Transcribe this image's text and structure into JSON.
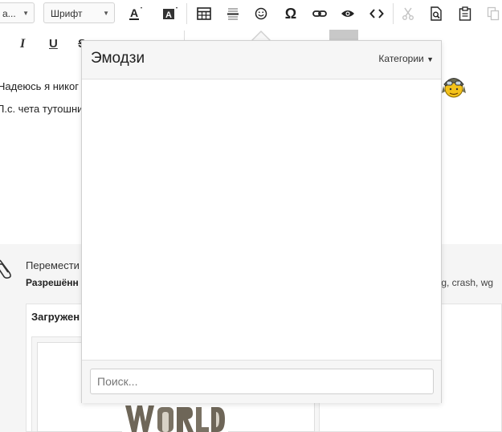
{
  "toolbar": {
    "style_select": "a...",
    "font_select": "Шрифт",
    "icons": [
      "font-color-icon",
      "background-color-icon",
      "table-icon",
      "horizontal-rule-icon",
      "smiley-icon",
      "omega-icon",
      "link-icon",
      "eye-icon",
      "code-icon",
      "cut-icon",
      "find-icon",
      "paste-icon",
      "copy-icon"
    ]
  },
  "format": {
    "italic": "I",
    "underline": "U",
    "strike": "S"
  },
  "editor": {
    "line1": "Надеюсь я никог",
    "line2": "П.с. чета тутошни"
  },
  "attachments": {
    "move_text": "Перемести",
    "allowed_label": "Разрешённ",
    "extensions": "log, crash, wg",
    "uploaded_title": "Загружен"
  },
  "emoji_popup": {
    "title": "Эмодзи",
    "categories_label": "Категории",
    "search_placeholder": "Поиск..."
  },
  "colors": {
    "accent_popup_bg": "#f6f6f6",
    "border": "#d0d0d0"
  }
}
